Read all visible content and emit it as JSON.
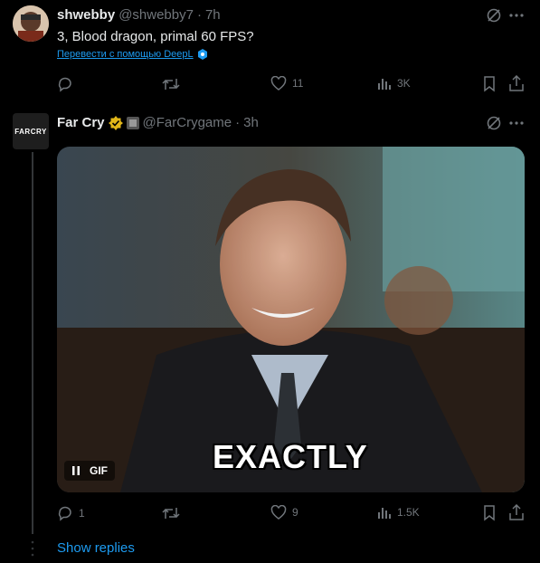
{
  "tweet1": {
    "name": "shwebby",
    "handle": "@shwebby7",
    "dot": "·",
    "time": "7h",
    "text": "3, Blood dragon, primal 60 FPS?",
    "translate": "Перевести с помощью DeepL",
    "actions": {
      "replies": "",
      "retweets": "",
      "likes": "11",
      "views": "3K"
    }
  },
  "tweet2": {
    "name": "Far Cry",
    "handle": "@FarCrygame",
    "dot": "·",
    "time": "3h",
    "avatar_text": "FARCRY",
    "media": {
      "caption": "EXACTLY",
      "badge": "GIF"
    },
    "actions": {
      "replies": "1",
      "retweets": "",
      "likes": "9",
      "views": "1.5K"
    }
  },
  "show_replies": "Show replies",
  "colors": {
    "accent": "#1d9bf0",
    "muted": "#71767b",
    "text": "#e7e9ea",
    "verified_gold": "#e2b719"
  },
  "icons": [
    "grok-icon",
    "more-icon",
    "reply-icon",
    "retweet-icon",
    "like-icon",
    "views-icon",
    "bookmark-icon",
    "share-icon",
    "verified-gold-icon",
    "affiliate-badge-icon",
    "pause-icon",
    "deepl-icon"
  ]
}
